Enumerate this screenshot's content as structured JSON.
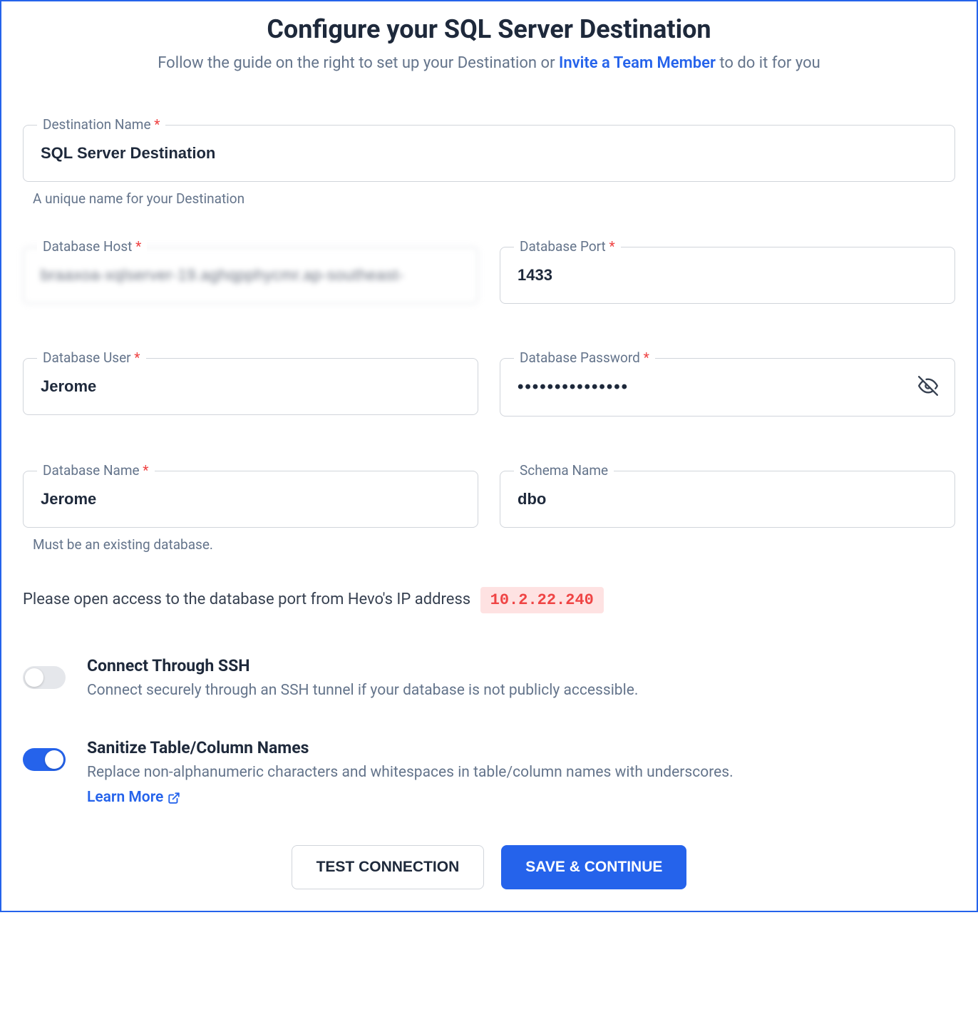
{
  "header": {
    "title": "Configure your SQL Server Destination",
    "subtitle_prefix": "Follow the guide on the right to set up your Destination or ",
    "subtitle_link": "Invite a Team Member",
    "subtitle_suffix": " to do it for you"
  },
  "fields": {
    "destination_name": {
      "label": "Destination Name",
      "required": true,
      "value": "SQL Server Destination",
      "hint": "A unique name for your Destination"
    },
    "database_host": {
      "label": "Database Host",
      "required": true,
      "value": "braaxoa-xqlserver-19.aghqpphycmr.ap-southeast-"
    },
    "database_port": {
      "label": "Database Port",
      "required": true,
      "value": "1433"
    },
    "database_user": {
      "label": "Database User",
      "required": true,
      "value": "Jerome"
    },
    "database_password": {
      "label": "Database Password",
      "required": true,
      "value": "•••••••••••••••"
    },
    "database_name": {
      "label": "Database Name",
      "required": true,
      "value": "Jerome",
      "hint": "Must be an existing database."
    },
    "schema_name": {
      "label": "Schema Name",
      "required": false,
      "value": "dbo"
    }
  },
  "ip_notice": {
    "text": "Please open access to the database port from Hevo's IP address",
    "ip": "10.2.22.240"
  },
  "toggles": {
    "ssh": {
      "title": "Connect Through SSH",
      "desc": "Connect securely through an SSH tunnel if your database is not publicly accessible.",
      "enabled": false
    },
    "sanitize": {
      "title": "Sanitize Table/Column Names",
      "desc": "Replace non-alphanumeric characters and whitespaces in table/column names with underscores. ",
      "learn_more": "Learn More",
      "enabled": true
    }
  },
  "buttons": {
    "test": "TEST CONNECTION",
    "save": "SAVE & CONTINUE"
  },
  "required_marker": " *"
}
